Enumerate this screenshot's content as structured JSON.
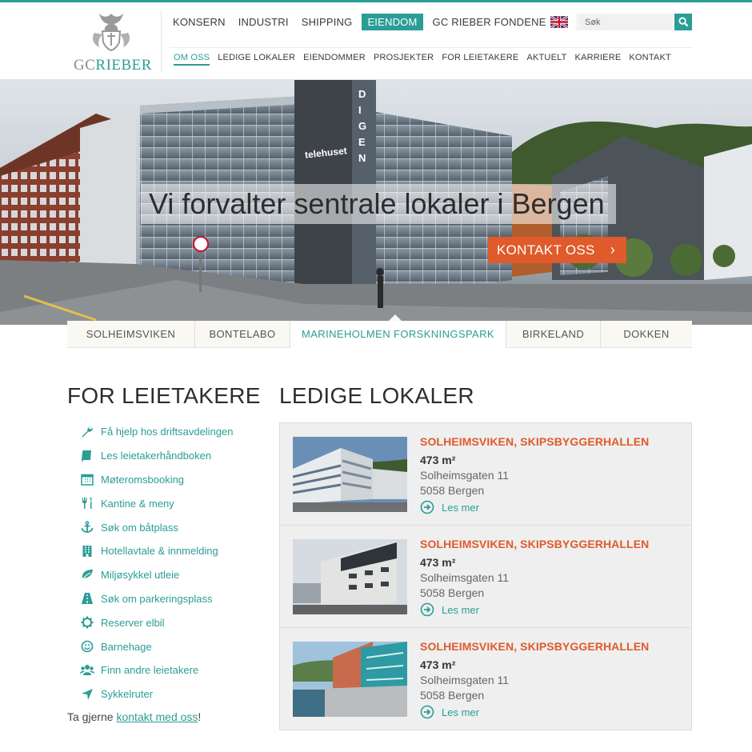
{
  "brand": {
    "logo_prefix": "GC",
    "logo_name": "RIEBER",
    "accent_color": "#2a9d96",
    "orange_color": "#e05a2b"
  },
  "main_nav": [
    {
      "label": "KONSERN",
      "active": false
    },
    {
      "label": "INDUSTRI",
      "active": false
    },
    {
      "label": "SHIPPING",
      "active": false
    },
    {
      "label": "EIENDOM",
      "active": true
    },
    {
      "label": "GC RIEBER FONDENE",
      "active": false
    }
  ],
  "language_icon": "uk-flag-icon",
  "search": {
    "placeholder": "Søk",
    "icon": "search-icon"
  },
  "sub_nav": [
    {
      "label": "OM OSS",
      "active": true
    },
    {
      "label": "LEDIGE LOKALER",
      "active": false
    },
    {
      "label": "EIENDOMMER",
      "active": false
    },
    {
      "label": "PROSJEKTER",
      "active": false
    },
    {
      "label": "FOR LEIETAKERE",
      "active": false
    },
    {
      "label": "AKTUELT",
      "active": false
    },
    {
      "label": "KARRIERE",
      "active": false
    },
    {
      "label": "KONTAKT",
      "active": false
    }
  ],
  "hero": {
    "title": "Vi forvalter sentrale lokaler i Bergen",
    "cta_label": "KONTAKT OSS",
    "building_signs": [
      "telehuset",
      "DIGEN"
    ],
    "speed_sign": "40"
  },
  "location_tabs": [
    {
      "label": "SOLHEIMSVIKEN",
      "active": false
    },
    {
      "label": "BONTELABO",
      "active": false
    },
    {
      "label": "MARINEHOLMEN FORSKNINGSPARK",
      "active": true
    },
    {
      "label": "BIRKELAND",
      "active": false
    },
    {
      "label": "DOKKEN",
      "active": false
    }
  ],
  "tenants": {
    "title": "FOR LEIETAKERE",
    "items": [
      {
        "label": "Få hjelp hos driftsavdelingen",
        "icon": "wrench-icon"
      },
      {
        "label": "Les leietakerhåndboken",
        "icon": "book-icon"
      },
      {
        "label": "Møteromsbooking",
        "icon": "calendar-icon"
      },
      {
        "label": "Kantine & meny",
        "icon": "cutlery-icon"
      },
      {
        "label": "Søk om båtplass",
        "icon": "anchor-icon"
      },
      {
        "label": "Hotellavtale & innmelding",
        "icon": "building-icon"
      },
      {
        "label": "Miljøsykkel utleie",
        "icon": "leaf-icon"
      },
      {
        "label": "Søk om parkeringsplass",
        "icon": "road-icon"
      },
      {
        "label": "Reserver elbil",
        "icon": "gear-icon"
      },
      {
        "label": "Barnehage",
        "icon": "smile-icon"
      },
      {
        "label": "Finn andre leietakere",
        "icon": "users-icon"
      },
      {
        "label": "Sykkelruter",
        "icon": "location-arrow-icon"
      }
    ],
    "contact_prefix": "Ta gjerne ",
    "contact_link": "kontakt med oss",
    "contact_suffix": "!"
  },
  "vacancies": {
    "title": "LEDIGE LOKALER",
    "items": [
      {
        "title": "SOLHEIMSVIKEN, SKIPSBYGGERHALLEN",
        "size": "473 m²",
        "street": "Solheimsgaten 11",
        "city": "5058 Bergen",
        "more": "Les mer"
      },
      {
        "title": "SOLHEIMSVIKEN, SKIPSBYGGERHALLEN",
        "size": "473 m²",
        "street": "Solheimsgaten 11",
        "city": "5058 Bergen",
        "more": "Les mer"
      },
      {
        "title": "SOLHEIMSVIKEN, SKIPSBYGGERHALLEN",
        "size": "473 m²",
        "street": "Solheimsgaten 11",
        "city": "5058 Bergen",
        "more": "Les mer"
      }
    ]
  }
}
